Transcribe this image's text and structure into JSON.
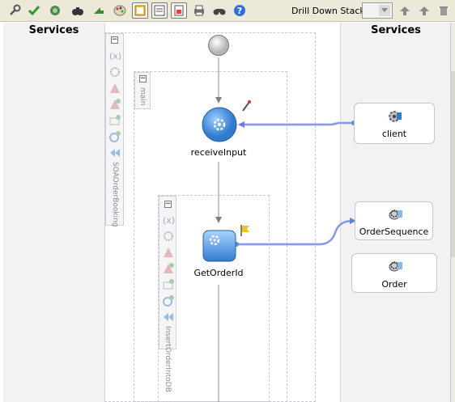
{
  "toolbar": {
    "drill_down_label": "Drill Down Stack:",
    "drill_down_value": "",
    "icons": [
      "wrench-icon",
      "validate-check-icon",
      "refresh-icon",
      "find-icon",
      "arrow-icon",
      "palette-icon",
      "layout-panel-icon",
      "properties-icon",
      "page-icon",
      "print-icon",
      "binoculars-icon",
      "help-icon"
    ]
  },
  "lanes": {
    "left_title": "Services",
    "right_title": "Services"
  },
  "scopes": {
    "outer_label": "SOAOrderBooking",
    "main_label": "main",
    "inner_label": "InsertOrderIntoDB"
  },
  "activities": {
    "receive_label": "receiveInput",
    "getorder_label": "GetOrderId"
  },
  "services": [
    {
      "label": "client"
    },
    {
      "label": "OrderSequence"
    },
    {
      "label": "Order"
    }
  ],
  "colors": {
    "activity_blue": "#3f8fd8",
    "link_blue": "#7f8fe8",
    "toolbar_bg": "#ece9d8"
  }
}
